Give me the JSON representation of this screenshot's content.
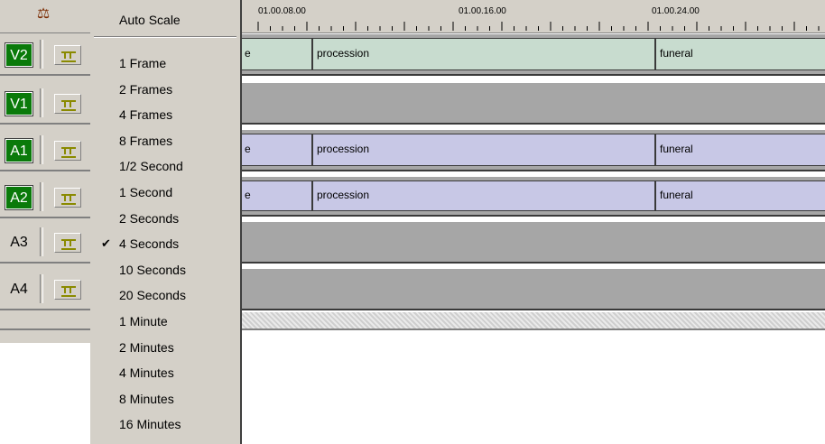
{
  "ruler": {
    "ticks": [
      "01.00.08.00",
      "01.00.16.00",
      "01.00.24.00"
    ]
  },
  "tracks": [
    {
      "name": "V2",
      "active": true
    },
    {
      "name": "V1",
      "active": true
    },
    {
      "name": "A1",
      "active": true
    },
    {
      "name": "A2",
      "active": true
    },
    {
      "name": "A3",
      "active": false
    },
    {
      "name": "A4",
      "active": false
    }
  ],
  "clips": {
    "V2": [
      "e",
      "procession",
      "funeral"
    ],
    "A1": [
      "e",
      "procession",
      "funeral"
    ],
    "A2": [
      "e",
      "procession",
      "funeral"
    ]
  },
  "menu": {
    "top_item": "Auto Scale",
    "items": [
      "1 Frame",
      "2 Frames",
      "4 Frames",
      "8 Frames",
      "1/2 Second",
      "1 Second",
      "2 Seconds",
      "4 Seconds",
      "10 Seconds",
      "20 Seconds",
      "1 Minute",
      "2 Minutes",
      "4 Minutes",
      "8 Minutes",
      "16 Minutes"
    ],
    "checked": "4 Seconds"
  },
  "icons": {
    "scale": "balance-scale-icon",
    "sync": "sync-lock-icon",
    "check": "checkmark-icon"
  },
  "colors": {
    "video_clip": "#c8dccf",
    "audio_clip": "#c8c8e6",
    "track_on": "#0a7a0a",
    "lane": "#a6a6a6"
  }
}
